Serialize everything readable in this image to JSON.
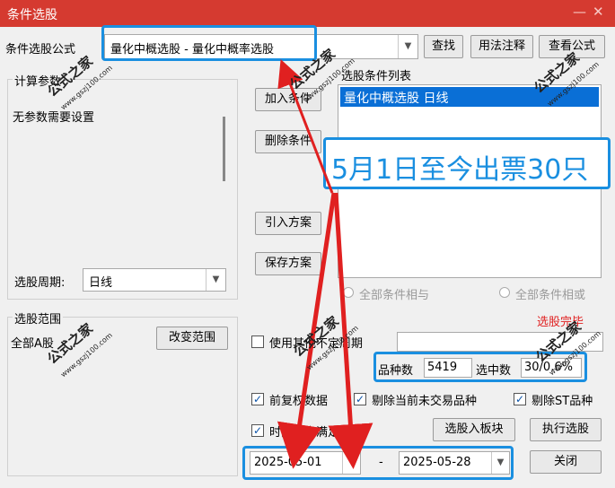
{
  "window": {
    "title": "条件选股",
    "minimize_glyph": "—",
    "close_glyph": "✕"
  },
  "formula": {
    "label": "条件选股公式",
    "selected": "量化中概选股 - 量化中概率选股",
    "find_button": "查找",
    "usage_button": "用法注释",
    "view_button": "查看公式"
  },
  "params": {
    "group_title": "计算参数",
    "text": "无参数需要设置"
  },
  "period": {
    "label": "选股周期:",
    "value": "日线"
  },
  "range": {
    "group_title": "选股范围",
    "value": "全部A股",
    "change_button": "改变范围"
  },
  "actions": {
    "add": "加入条件",
    "delete": "删除条件",
    "import": "引入方案",
    "save": "保存方案"
  },
  "conditions": {
    "title": "选股条件列表",
    "items": [
      "量化中概选股  日线"
    ],
    "radio_and": "全部条件相与",
    "radio_or": "全部条件相或",
    "result_status": "选股完毕"
  },
  "options": {
    "use_custom_period": "使用其他不定周期",
    "pre_restore": "前复权数据",
    "exclude_untraded": "剔除当前未交易品种",
    "exclude_st": "剔除ST品种",
    "time_range": "时间段内满足条件"
  },
  "stats": {
    "count_label": "品种数",
    "count_value": "5419",
    "selected_label": "选中数",
    "selected_value": "30/0.6%"
  },
  "dates": {
    "start": "2025-05-01",
    "separator": "-",
    "end": "2025-05-28"
  },
  "bottom": {
    "to_block": "选股入板块",
    "execute": "执行选股",
    "close": "关闭"
  },
  "annotation": {
    "text": "5月1日至今出票30只",
    "color": "#1a8fe0"
  },
  "watermark": {
    "main": "公式之家",
    "sub": "www.gszj100.com"
  },
  "colors": {
    "titlebar": "#d53a30",
    "selection": "#0a6fd6",
    "accent_red": "#e02020",
    "highlight_blue": "#1a8fe0"
  }
}
